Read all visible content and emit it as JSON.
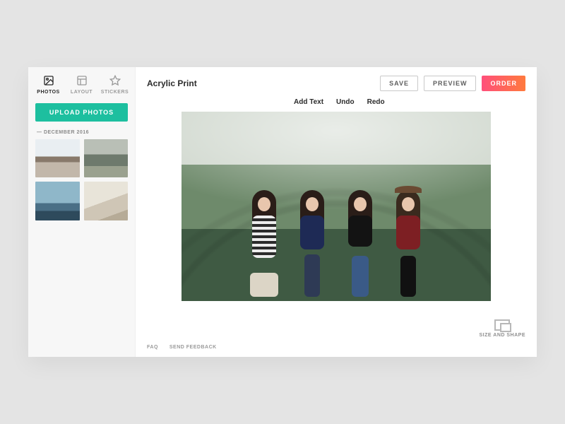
{
  "sidebar": {
    "tabs": [
      {
        "label": "PHOTOS"
      },
      {
        "label": "LAYOUT"
      },
      {
        "label": "STICKERS"
      }
    ],
    "upload_label": "UPLOAD PHOTOS",
    "group_label": "— DECEMBER 2016"
  },
  "header": {
    "title": "Acrylic Print",
    "save": "SAVE",
    "preview": "PREVIEW",
    "order": "ORDER"
  },
  "tools": {
    "add_text": "Add Text",
    "undo": "Undo",
    "redo": "Redo"
  },
  "sizeshape_label": "SIZE AND SHAPE",
  "footer": {
    "faq": "FAQ",
    "feedback": "SEND FEEDBACK"
  }
}
